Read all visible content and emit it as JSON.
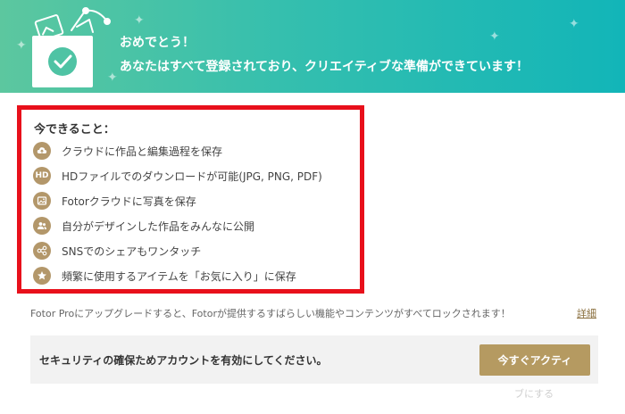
{
  "banner": {
    "title": "おめでとう！",
    "subtitle": "あなたはすべて登録されており、クリエイティブな準備ができています！",
    "colors": {
      "start": "#5cc79f",
      "end": "#12b5b8"
    }
  },
  "features": {
    "heading": "今できること：",
    "items": [
      {
        "icon": "cloud-upload-icon",
        "label": "クラウドに作品と編集過程を保存"
      },
      {
        "icon": "hd-icon",
        "icon_text": "HD",
        "label": "HDファイルでのダウンロードが可能(JPG, PNG, PDF)"
      },
      {
        "icon": "image-icon",
        "label": "Fotorクラウドに写真を保存"
      },
      {
        "icon": "users-icon",
        "label": "自分がデザインした作品をみんなに公開"
      },
      {
        "icon": "share-icon",
        "label": "SNSでのシェアもワンタッチ"
      },
      {
        "icon": "star-icon",
        "label": "頻繁に使用するアイテムを「お気に入り」に保存"
      }
    ],
    "border_color": "#e8101b",
    "icon_color": "#b3976a"
  },
  "pro_note": {
    "text": "Fotor Proにアップグレードすると、Fotorが提供するすばらしい機能やコンテンツがすべてロックされます！",
    "link": "詳細"
  },
  "security": {
    "text": "セキュリティの確保ためアカウントを有効にしてください。",
    "button_label": "今すぐアクティ",
    "button_overflow": "ブにする",
    "button_color": "#b59a61"
  }
}
